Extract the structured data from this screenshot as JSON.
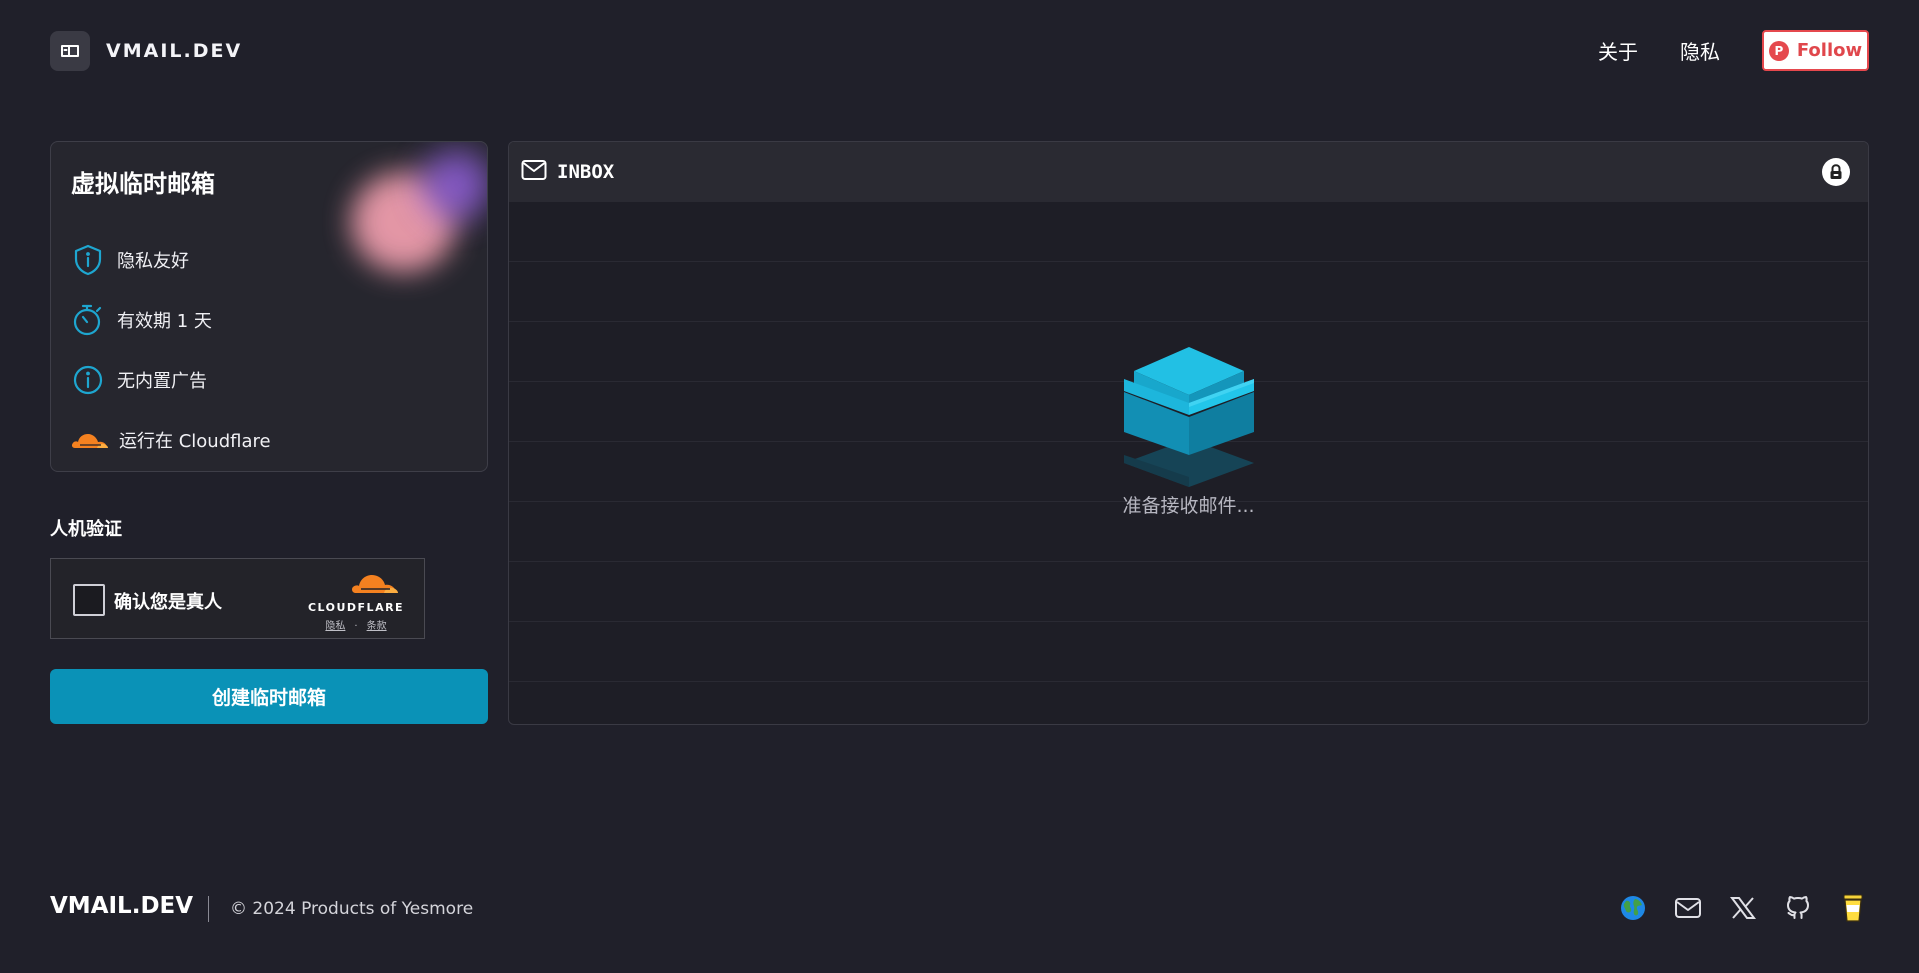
{
  "header": {
    "brand": "VMAIL.DEV",
    "nav": [
      {
        "label": "关于"
      },
      {
        "label": "隐私"
      }
    ],
    "follow_label": "Follow",
    "follow_badge": "P"
  },
  "features": {
    "title": "虚拟临时邮箱",
    "items": [
      {
        "label": "隐私友好",
        "icon": "shield-icon"
      },
      {
        "label": "有效期 1 天",
        "icon": "stopwatch-icon"
      },
      {
        "label": "无内置广告",
        "icon": "info-icon"
      },
      {
        "label": "运行在 Cloudflare",
        "icon": "cloudflare-icon"
      }
    ]
  },
  "verification": {
    "title": "人机验证",
    "checkbox_label": "确认您是真人",
    "cf_brand": "CLOUDFLARE",
    "privacy_link": "隐私",
    "separator": "·",
    "terms_link": "条款"
  },
  "create_button": "创建临时邮箱",
  "inbox": {
    "title": "INBOX",
    "empty_text": "准备接收邮件..."
  },
  "footer": {
    "brand": "VMAIL.DEV",
    "copyright": "© 2024 Products of Yesmore",
    "icons": [
      "globe-icon",
      "mail-icon",
      "x-icon",
      "github-icon",
      "coffee-icon"
    ]
  },
  "colors": {
    "background": "#20202a",
    "accent": "#0a92b7",
    "icon_teal": "#1ea6d0",
    "cloudflare_orange": "#f48120",
    "follow_red": "#e5484d"
  }
}
